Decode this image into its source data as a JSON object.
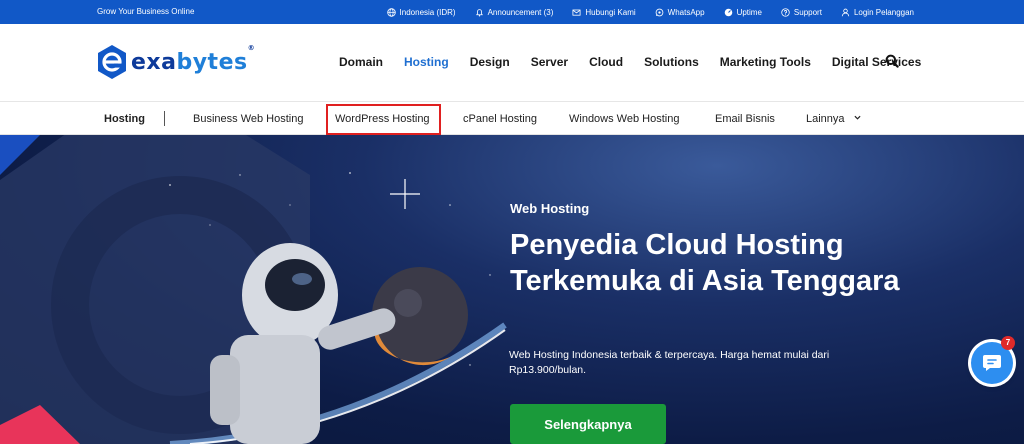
{
  "topbar": {
    "tagline": "Grow Your Business Online",
    "links": [
      {
        "icon": "globe-icon",
        "label": "Indonesia (IDR)"
      },
      {
        "icon": "bell-icon",
        "label": "Announcement (3)"
      },
      {
        "icon": "mail-icon",
        "label": "Hubungi Kami"
      },
      {
        "icon": "whatsapp-icon",
        "label": "WhatsApp"
      },
      {
        "icon": "gauge-icon",
        "label": "Uptime"
      },
      {
        "icon": "help-icon",
        "label": "Support"
      },
      {
        "icon": "user-icon",
        "label": "Login Pelanggan"
      }
    ]
  },
  "logo": {
    "text_start": "exa",
    "text_end": "bytes",
    "registered": "®"
  },
  "main_nav": {
    "items": [
      "Domain",
      "Hosting",
      "Design",
      "Server",
      "Cloud",
      "Solutions",
      "Marketing Tools",
      "Digital Services"
    ],
    "active": "Hosting"
  },
  "sub_nav": {
    "title": "Hosting",
    "items": [
      "Business Web Hosting",
      "WordPress Hosting",
      "cPanel Hosting",
      "Windows Web Hosting",
      "Email Bisnis",
      "Lainnya"
    ],
    "highlighted": "WordPress Hosting"
  },
  "hero": {
    "eyebrow": "Web Hosting",
    "headline": "Penyedia Cloud Hosting Terkemuka di Asia Tenggara",
    "description": "Web Hosting Indonesia terbaik & terpercaya. Harga hemat mulai dari Rp13.900/bulan.",
    "cta_label": "Selengkapnya"
  },
  "chat_widget": {
    "badge_count": "7"
  },
  "colors": {
    "topbar_bg": "#1158c7",
    "brand_dark": "#0d3a9a",
    "brand_light": "#1f7fd8",
    "active_nav": "#1f6fd1",
    "highlight_border": "#e02020",
    "cta_bg": "#1a9a3a",
    "chat_bg": "#2d8ef0",
    "badge_bg": "#e02a2a"
  }
}
